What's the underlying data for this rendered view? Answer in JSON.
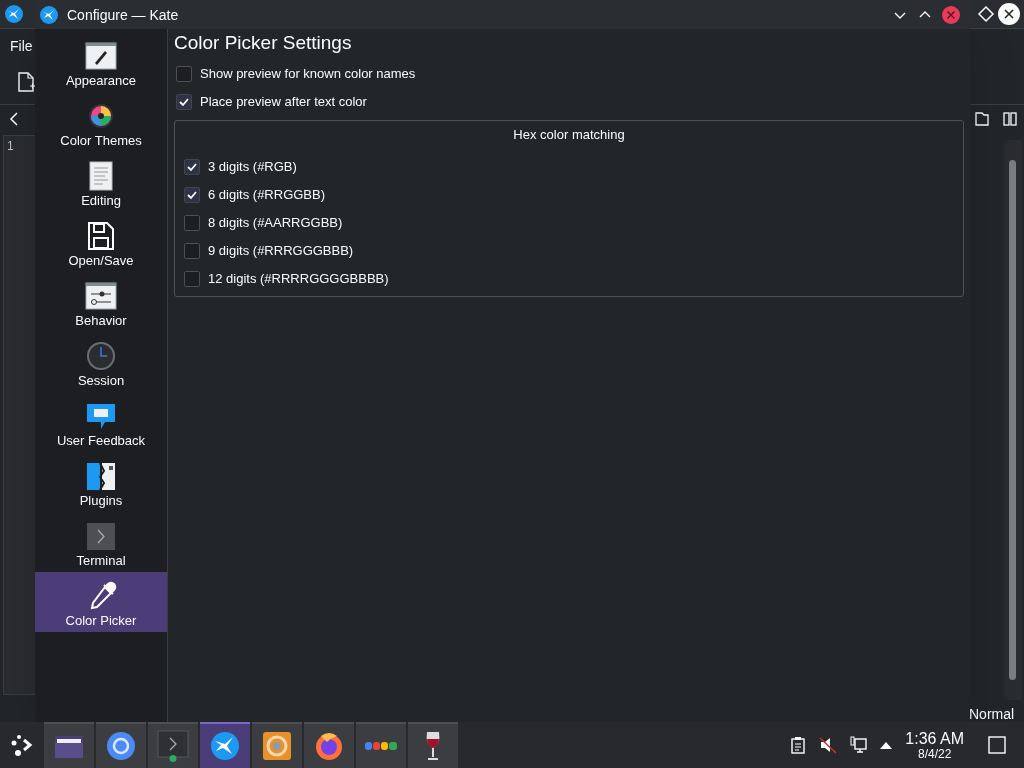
{
  "background_window": {
    "menu": [
      "File"
    ],
    "line_numbers": [
      "1"
    ],
    "mode": "Normal"
  },
  "dialog": {
    "title": "Configure — Kate",
    "sidebar": {
      "items": [
        {
          "kind": "appearance",
          "label": "Appearance",
          "selected": false
        },
        {
          "kind": "color-themes",
          "label": "Color Themes",
          "selected": false
        },
        {
          "kind": "editing",
          "label": "Editing",
          "selected": false
        },
        {
          "kind": "open-save",
          "label": "Open/Save",
          "selected": false
        },
        {
          "kind": "behavior",
          "label": "Behavior",
          "selected": false
        },
        {
          "kind": "session",
          "label": "Session",
          "selected": false
        },
        {
          "kind": "feedback",
          "label": "User Feedback",
          "selected": false
        },
        {
          "kind": "plugins",
          "label": "Plugins",
          "selected": false
        },
        {
          "kind": "terminal",
          "label": "Terminal",
          "selected": false
        },
        {
          "kind": "color-picker",
          "label": "Color Picker",
          "selected": true
        }
      ]
    },
    "page": {
      "title": "Color Picker Settings",
      "options": [
        {
          "label": "Show preview for known color names",
          "checked": false
        },
        {
          "label": "Place preview after text color",
          "checked": true
        }
      ],
      "group": {
        "title": "Hex color matching",
        "options": [
          {
            "label": "3 digits (#RGB)",
            "checked": true
          },
          {
            "label": "6 digits (#RRGGBB)",
            "checked": true
          },
          {
            "label": "8 digits (#AARRGGBB)",
            "checked": false
          },
          {
            "label": "9 digits (#RRRGGGBBB)",
            "checked": false
          },
          {
            "label": "12 digits (#RRRRGGGGBBBB)",
            "checked": false
          }
        ]
      }
    }
  },
  "taskbar": {
    "tasks": [
      {
        "kind": "folder",
        "selected": false
      },
      {
        "kind": "browser",
        "selected": false
      },
      {
        "kind": "terminal",
        "selected": false
      },
      {
        "kind": "kate",
        "selected": true
      },
      {
        "kind": "swirl",
        "selected": false
      },
      {
        "kind": "firefox",
        "selected": false
      },
      {
        "kind": "google",
        "selected": false
      },
      {
        "kind": "wine",
        "selected": false
      }
    ],
    "clock": {
      "time": "1:36 AM",
      "date": "8/4/22"
    }
  }
}
